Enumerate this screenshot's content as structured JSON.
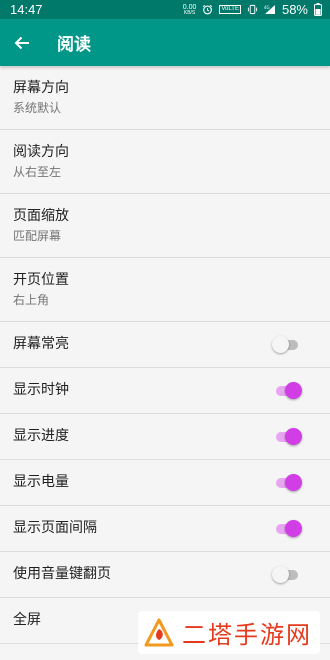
{
  "status_bar": {
    "time": "14:47",
    "net_speed_value": "0.00",
    "net_speed_unit": "KB/S",
    "volte": "VoLTE",
    "battery_percent": "58%",
    "icons": [
      "alarm-icon",
      "vibrate-icon",
      "signal-icon",
      "battery-icon"
    ]
  },
  "app_bar": {
    "title": "阅读",
    "back_icon": "arrow-left-icon"
  },
  "settings": [
    {
      "title": "屏幕方向",
      "summary": "系统默认"
    },
    {
      "title": "阅读方向",
      "summary": "从右至左"
    },
    {
      "title": "页面缩放",
      "summary": "匹配屏幕"
    },
    {
      "title": "开页位置",
      "summary": "右上角"
    },
    {
      "title": "屏幕常亮",
      "enabled": false
    },
    {
      "title": "显示时钟",
      "enabled": true
    },
    {
      "title": "显示进度",
      "enabled": true
    },
    {
      "title": "显示电量",
      "enabled": true
    },
    {
      "title": "显示页面间隔",
      "enabled": true
    },
    {
      "title": "使用音量键翻页",
      "enabled": false
    },
    {
      "title": "全屏"
    }
  ],
  "colors": {
    "status_bar": "#00796b",
    "app_bar": "#009688",
    "switch_on": "#d23ee6",
    "switch_off": "#f5f5f5"
  },
  "watermark": {
    "text": "二塔手游网"
  }
}
